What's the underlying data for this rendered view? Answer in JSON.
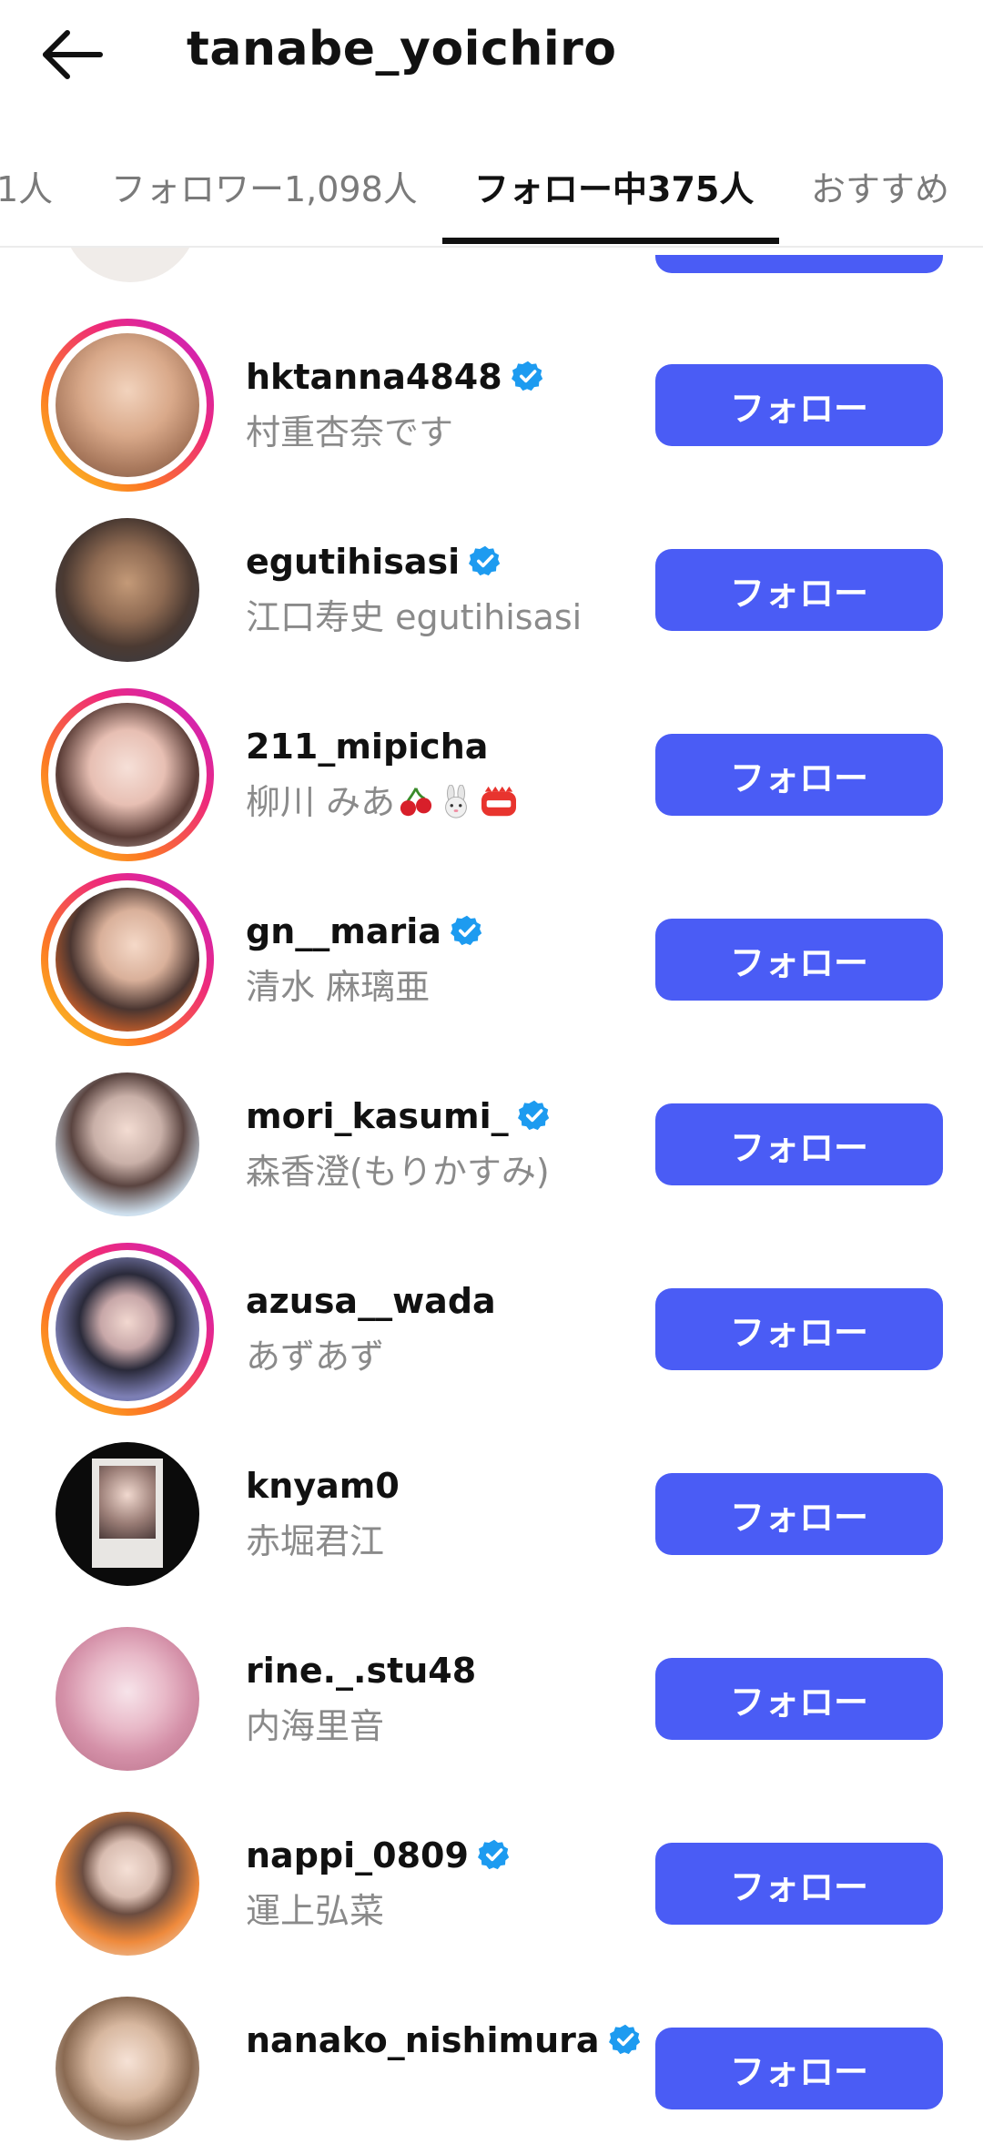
{
  "header": {
    "title": "tanabe_yoichiro"
  },
  "tabs": [
    {
      "label": "1人"
    },
    {
      "label": "フォロワー1,098人"
    },
    {
      "label": "フォロー中375人"
    },
    {
      "label": "おすすめ"
    }
  ],
  "users": [
    {
      "username": "hktanna4848",
      "name": "村重杏奈です",
      "verified": true,
      "ring": true,
      "button": "フォロー"
    },
    {
      "username": "egutihisasi",
      "name": "江口寿史 egutihisasi",
      "verified": true,
      "ring": false,
      "button": "フォロー"
    },
    {
      "username": "211_mipicha",
      "name": "柳川 みあ",
      "verified": false,
      "ring": true,
      "button": "フォロー"
    },
    {
      "username": "gn__maria",
      "name": "清水 麻璃亜",
      "verified": true,
      "ring": true,
      "button": "フォロー"
    },
    {
      "username": "mori_kasumi_",
      "name": "森香澄(もりかすみ)",
      "verified": true,
      "ring": false,
      "button": "フォロー"
    },
    {
      "username": "azusa__wada",
      "name": "あずあず",
      "verified": false,
      "ring": true,
      "button": "フォロー"
    },
    {
      "username": "knyam0",
      "name": "赤堀君江",
      "verified": false,
      "ring": false,
      "button": "フォロー"
    },
    {
      "username": "rine._.stu48",
      "name": "内海里音",
      "verified": false,
      "ring": false,
      "button": "フォロー"
    },
    {
      "username": "nappi_0809",
      "name": "運上弘菜",
      "verified": true,
      "ring": false,
      "button": "フォロー"
    },
    {
      "username": "nanako_nishimura",
      "name": "",
      "verified": true,
      "ring": false,
      "button": "フォロー"
    }
  ],
  "colors": {
    "follow_button": "#4a5cf5",
    "verified": "#1d9bf0"
  }
}
